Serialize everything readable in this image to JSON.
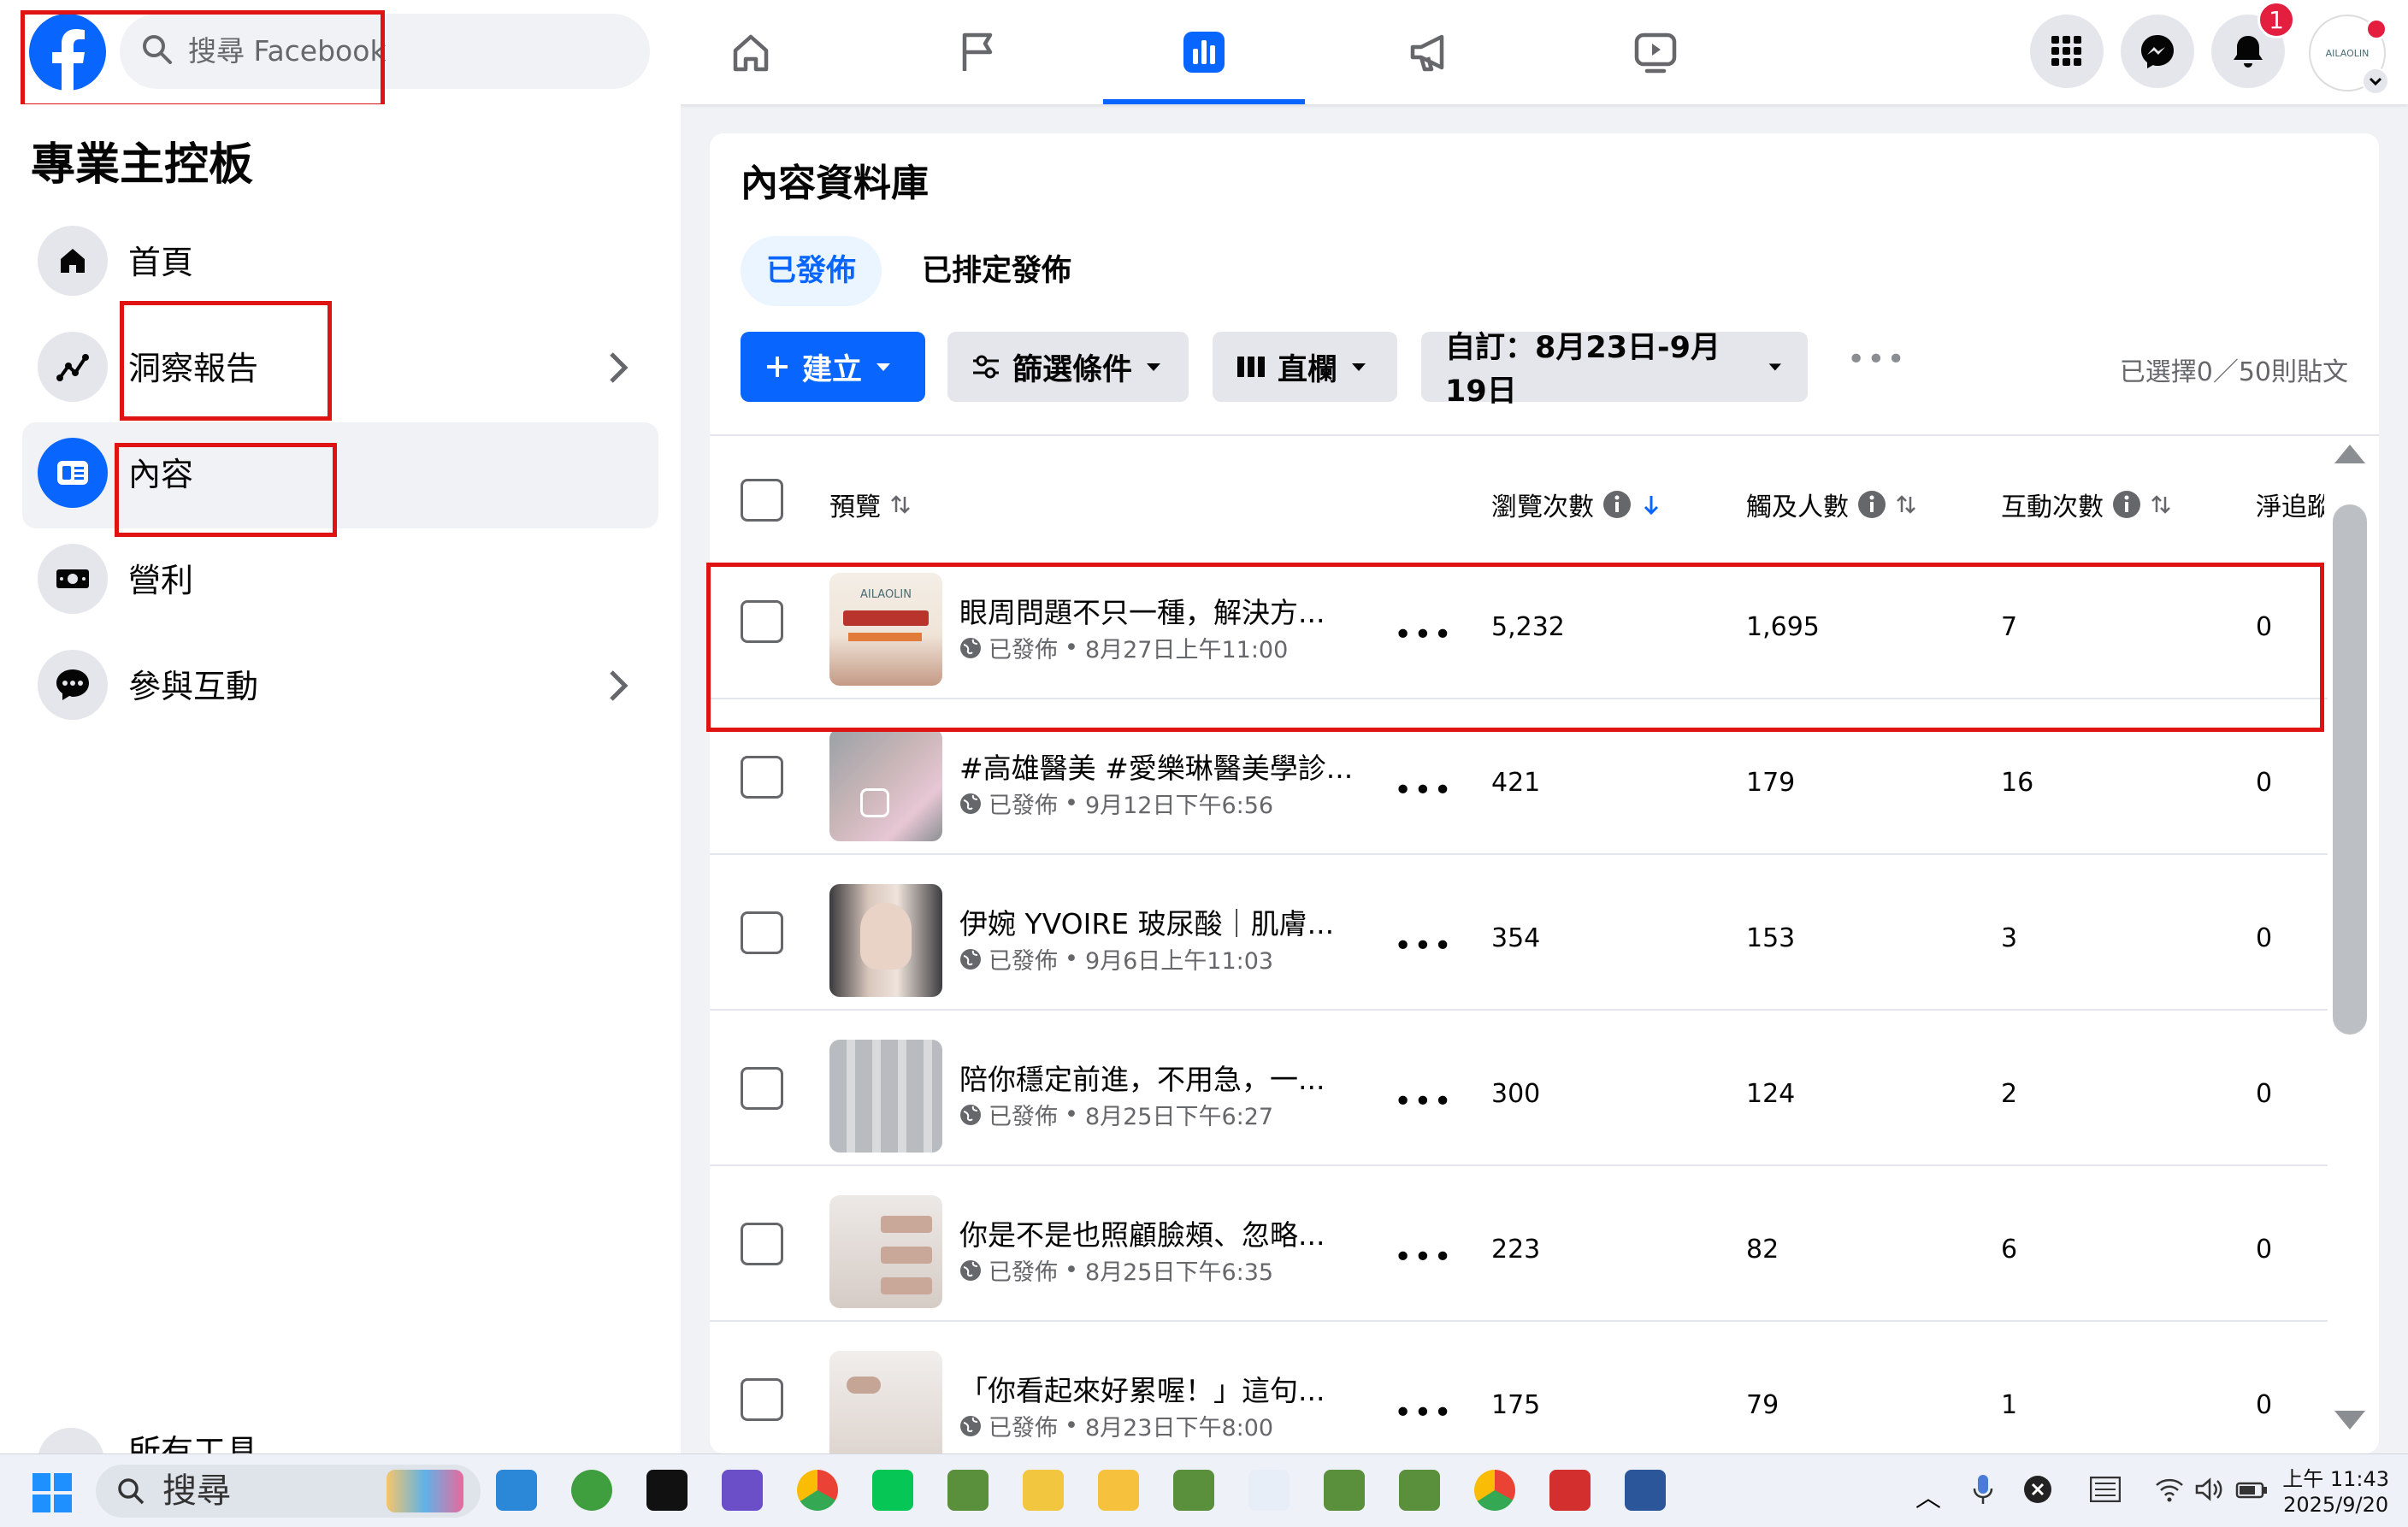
{
  "header": {
    "search_placeholder": "搜尋 Facebook",
    "notification_count": "1",
    "avatar_text": "AILAOLIN"
  },
  "sidebar": {
    "title": "專業主控板",
    "items": [
      {
        "label": "首頁",
        "icon": "home-icon"
      },
      {
        "label": "洞察報告",
        "icon": "insights-icon"
      },
      {
        "label": "內容",
        "icon": "content-icon"
      },
      {
        "label": "營利",
        "icon": "money-icon"
      },
      {
        "label": "參與互動",
        "icon": "chat-icon"
      }
    ],
    "cutoff_label": "所有工具"
  },
  "content": {
    "title": "內容資料庫",
    "tabs": [
      "已發佈",
      "已排定發佈"
    ],
    "buttons": {
      "create": "建立",
      "filter": "篩選條件",
      "columns": "直欄",
      "date_range": "自訂：8月23日-9月19日"
    },
    "selected_count": "已選擇0／50則貼文",
    "columns": [
      "預覽",
      "瀏覽次數",
      "觸及人數",
      "互動次數",
      "淨追蹤"
    ],
    "posts": [
      {
        "title": "眼周問題不只一種，解決方...",
        "status": "已發佈",
        "date": "8月27日上午11:00",
        "views": "5,232",
        "reach": "1,695",
        "interactions": "7",
        "net_follows": "0"
      },
      {
        "title": "#高雄醫美 #愛樂琳醫美學診...",
        "status": "已發佈",
        "date": "9月12日下午6:56",
        "views": "421",
        "reach": "179",
        "interactions": "16",
        "net_follows": "0"
      },
      {
        "title": "伊婉 YVOIRE 玻尿酸｜肌膚...",
        "status": "已發佈",
        "date": "9月6日上午11:03",
        "views": "354",
        "reach": "153",
        "interactions": "3",
        "net_follows": "0"
      },
      {
        "title": "陪你穩定前進，不用急，一...",
        "status": "已發佈",
        "date": "8月25日下午6:27",
        "views": "300",
        "reach": "124",
        "interactions": "2",
        "net_follows": "0"
      },
      {
        "title": "你是不是也照顧臉頰、忽略...",
        "status": "已發佈",
        "date": "8月25日下午6:35",
        "views": "223",
        "reach": "82",
        "interactions": "6",
        "net_follows": "0"
      },
      {
        "title": "「你看起來好累喔！」這句...",
        "status": "已發佈",
        "date": "8月23日下午8:00",
        "views": "175",
        "reach": "79",
        "interactions": "1",
        "net_follows": "0"
      }
    ]
  },
  "taskbar": {
    "search": "搜尋",
    "time": "上午 11:43",
    "date": "2025/9/20"
  },
  "colors": {
    "brand": "#0866ff",
    "highlight": "#e01313",
    "badge": "#e41e3f"
  }
}
